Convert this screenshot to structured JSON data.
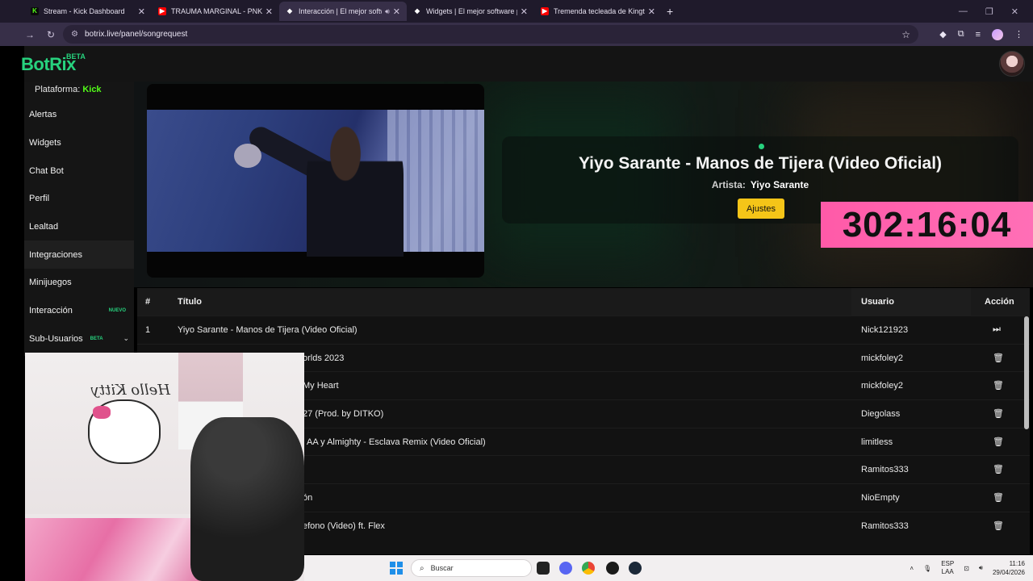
{
  "browser": {
    "tabs": [
      {
        "title": "Stream - Kick Dashboard",
        "fav_color": "#53fc18",
        "fav_glyph": "K"
      },
      {
        "title": "TRAUMA MARGINAL - PNKZ 🔥",
        "fav_color": "#ff0000",
        "fav_glyph": "▶"
      },
      {
        "title": "Interacción | El mejor softw",
        "fav_color": "#ffffff",
        "fav_glyph": "◆"
      },
      {
        "title": "Widgets | El mejor software par",
        "fav_color": "#ffffff",
        "fav_glyph": "◆"
      },
      {
        "title": "Tremenda tecleada de Kingteka",
        "fav_color": "#ff0000",
        "fav_glyph": "▶"
      }
    ],
    "url": "botrix.live/panel/songrequest"
  },
  "app": {
    "logo": "BotRix",
    "logo_badge": "BETA"
  },
  "sidebar": {
    "platform_label": "Plataforma:",
    "platform_value": "Kick",
    "items": [
      {
        "label": "Alertas"
      },
      {
        "label": "Widgets"
      },
      {
        "label": "Chat Bot"
      },
      {
        "label": "Perfil"
      },
      {
        "label": "Lealtad"
      },
      {
        "label": "Integraciones"
      },
      {
        "label": "Minijuegos"
      },
      {
        "label": "Interacción",
        "badge": "NUEVO"
      },
      {
        "label": "Sub-Usuarios",
        "badge": "BETA"
      }
    ]
  },
  "player": {
    "song_title": "Yiyo Sarante - Manos de Tijera (Video Oficial)",
    "artist_label": "Artista:",
    "artist_name": "Yiyo Sarante",
    "settings_button": "Ajustes",
    "accent": "#27d27e",
    "button_color": "#f5c518"
  },
  "timer": {
    "value": "302:16:04",
    "color": "#ff5aa8"
  },
  "queue": {
    "headers": {
      "num": "#",
      "title": "Título",
      "user": "Usuario",
      "action": "Acción"
    },
    "rows": [
      {
        "num": "1",
        "title": "Yiyo Sarante - Manos de Tijera (Video Oficial)",
        "user": "Nick121923",
        "action": "skip"
      },
      {
        "num": "",
        "title": "orlds 2023",
        "user": "mickfoley2",
        "action": "delete"
      },
      {
        "num": "",
        "title": "My Heart",
        "user": "mickfoley2",
        "action": "delete"
      },
      {
        "num": "",
        "title": "27 (Prod. by DITKO)",
        "user": "Diegolass",
        "action": "delete"
      },
      {
        "num": "",
        "title": "AA y Almighty - Esclava Remix (Video Oficial)",
        "user": "limitless",
        "action": "delete"
      },
      {
        "num": "",
        "title": "",
        "user": "Ramitos333",
        "action": "delete"
      },
      {
        "num": "",
        "title": "ón",
        "user": "NioEmpty",
        "action": "delete"
      },
      {
        "num": "",
        "title": "efono (Video) ft. Flex",
        "user": "Ramitos333",
        "action": "delete"
      }
    ]
  },
  "webcam": {
    "sign_text": "Hello Kitty"
  },
  "taskbar": {
    "search_placeholder": "Buscar",
    "lang_top": "ESP",
    "lang_bottom": "LAA",
    "time": "11:16",
    "date": "29/04/2026"
  }
}
